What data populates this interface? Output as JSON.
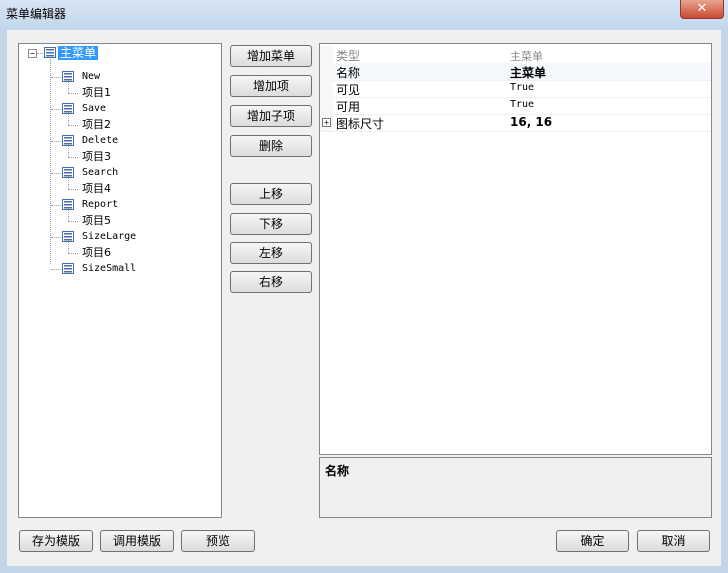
{
  "window": {
    "title": "菜单编辑器",
    "close_glyph": "✕"
  },
  "tree": {
    "root_label": "主菜单",
    "items": [
      {
        "label": "New",
        "child": "项目1"
      },
      {
        "label": "Save",
        "child": "项目2"
      },
      {
        "label": "Delete",
        "child": "项目3"
      },
      {
        "label": "Search",
        "child": "项目4"
      },
      {
        "label": "Report",
        "child": "项目5"
      },
      {
        "label": "SizeLarge",
        "child": "项目6"
      }
    ],
    "last_item": "SizeSmall",
    "expander_glyph": "−"
  },
  "buttons": {
    "add_menu": "增加菜单",
    "add_item": "增加项",
    "add_subitem": "增加子项",
    "delete": "删除",
    "move_up": "上移",
    "move_down": "下移",
    "move_left": "左移",
    "move_right": "右移",
    "save_template": "存为模版",
    "load_template": "调用模版",
    "preview": "预览",
    "ok": "确定",
    "cancel": "取消"
  },
  "properties": {
    "rows": [
      {
        "name": "类型",
        "value": "主菜单",
        "muted": true
      },
      {
        "name": "名称",
        "value": "主菜单",
        "bold": true
      },
      {
        "name": "可见",
        "value": "True"
      },
      {
        "name": "可用",
        "value": "True"
      },
      {
        "name": "图标尺寸",
        "value": "16, 16",
        "bold": true,
        "expandable": true
      }
    ],
    "plus_glyph": "+"
  },
  "description": {
    "title": "名称"
  }
}
